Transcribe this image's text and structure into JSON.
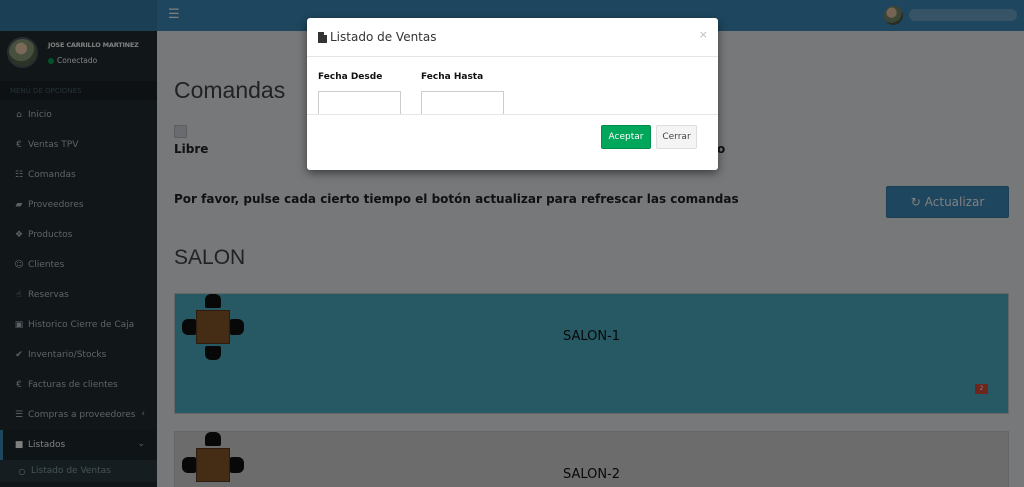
{
  "topbar": {
    "menu_icon": "bars-icon"
  },
  "user": {
    "name": "JOSE CARRILLO MARTINEZ",
    "status": "Conectado"
  },
  "sidebar": {
    "header": "MENÚ DE OPCIONES",
    "items": [
      {
        "label": "Inicio",
        "icon": "home-icon",
        "glyph": "⌂"
      },
      {
        "label": "Ventas TPV",
        "icon": "euro-icon",
        "glyph": "€"
      },
      {
        "label": "Comandas",
        "icon": "grid-icon",
        "glyph": "☷"
      },
      {
        "label": "Proveedores",
        "icon": "truck-icon",
        "glyph": "▰"
      },
      {
        "label": "Productos",
        "icon": "cubes-icon",
        "glyph": "❖"
      },
      {
        "label": "Clientes",
        "icon": "users-icon",
        "glyph": "☺"
      },
      {
        "label": "Reservas",
        "icon": "thumbs-up-icon",
        "glyph": "☝"
      },
      {
        "label": "Historico Cierre de Caja",
        "icon": "money-icon",
        "glyph": "▣"
      },
      {
        "label": "Inventario/Stocks",
        "icon": "check-icon",
        "glyph": "✔"
      },
      {
        "label": "Facturas de clientes",
        "icon": "euro-icon",
        "glyph": "€"
      },
      {
        "label": "Compras a proveedores",
        "icon": "cart-icon",
        "glyph": "☰"
      },
      {
        "label": "Listados",
        "icon": "file-icon",
        "glyph": "■"
      },
      {
        "label": "Listado de Ventas",
        "icon": "circle-icon",
        "glyph": "○"
      }
    ]
  },
  "content": {
    "title": "Comandas",
    "legend_libre": "Libre",
    "legend_ocupado": "o",
    "notice": "Por favor, pulse cada cierto tiempo el botón actualizar para refrescar las comandas",
    "refresh_label": "Actualizar",
    "section": "SALON",
    "rooms": [
      {
        "name": "SALON-1",
        "badge": "2",
        "color": "#4fb3c9"
      },
      {
        "name": "SALON-2",
        "color": "#d9d9d9"
      }
    ]
  },
  "modal": {
    "title": "Listado de Ventas",
    "close": "×",
    "fecha_desde_label": "Fecha Desde",
    "fecha_hasta_label": "Fecha Hasta",
    "fecha_desde_value": "",
    "fecha_hasta_value": "",
    "accept_label": "Aceptar",
    "cancel_label": "Cerrar"
  },
  "colors": {
    "topbar": "#3c8dbc",
    "sidebar": "#222d32",
    "accept": "#00a65a",
    "badge": "#dd4b39"
  }
}
